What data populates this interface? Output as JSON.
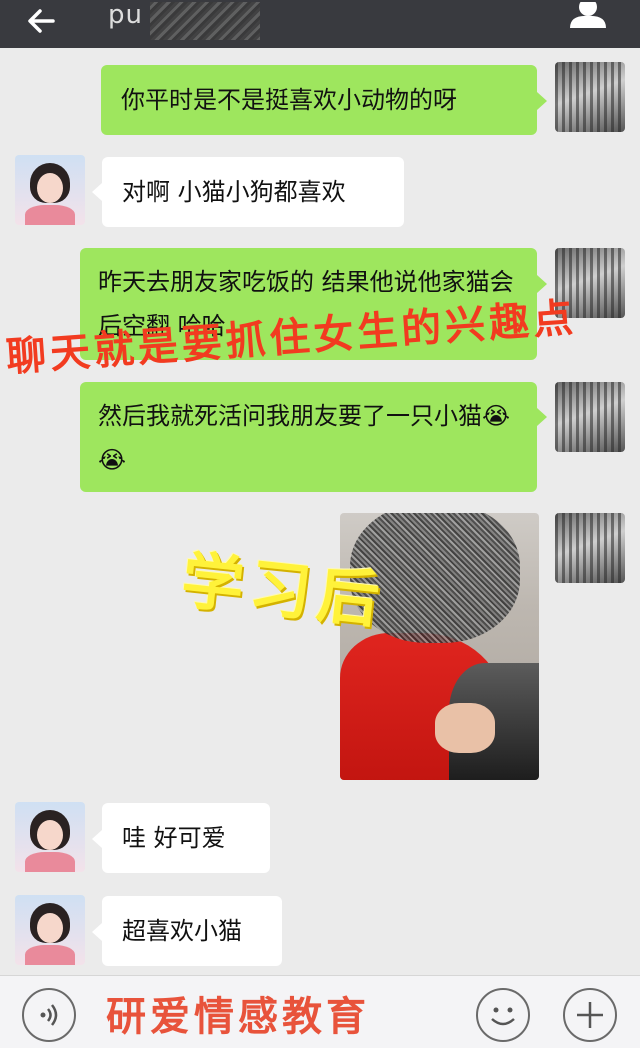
{
  "header": {
    "title": "pu",
    "back_icon": "arrow-left-icon",
    "profile_icon": "person-icon"
  },
  "messages": [
    {
      "side": "out",
      "text": "你平时是不是挺喜欢小动物的呀"
    },
    {
      "side": "in",
      "text": "对啊  小猫小狗都喜欢"
    },
    {
      "side": "out",
      "text": "昨天去朋友家吃饭的  结果他说他家猫会后空翻  哈哈"
    },
    {
      "side": "out",
      "text": "然后我就死活问我朋友要了一只小猫😭😭"
    },
    {
      "side": "out",
      "type": "image",
      "alt": "photo"
    },
    {
      "side": "in",
      "text": "哇  好可爱"
    },
    {
      "side": "in",
      "text": "超喜欢小猫"
    }
  ],
  "overlays": {
    "caption_top": "聊天就是要抓住女生的兴趣点",
    "caption_mid": "学习后",
    "caption_bottom": "研爱情感教育"
  },
  "inputbar": {
    "voice_icon": "voice-icon",
    "emoji_icon": "emoji-icon",
    "plus_icon": "plus-icon"
  },
  "colors": {
    "topbar": "#393a3f",
    "background": "#ebebeb",
    "outgoing_bubble": "#9ee65e",
    "incoming_bubble": "#ffffff",
    "overlay_red": "#f23b20",
    "overlay_yellow": "#fff23a"
  }
}
